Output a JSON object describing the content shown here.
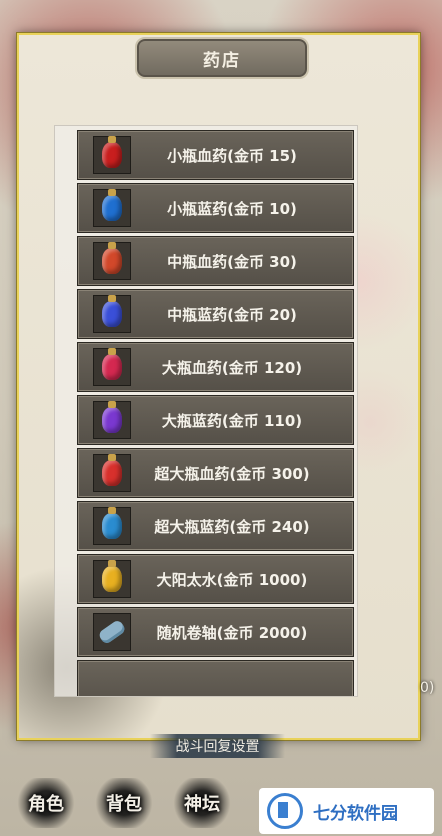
{
  "shop": {
    "title": "药店",
    "items": [
      {
        "label": "小瓶血药(金币 15)",
        "color": "#c81e1e",
        "icon": "small-red-potion-icon"
      },
      {
        "label": "小瓶蓝药(金币 10)",
        "color": "#1f6fd0",
        "icon": "small-blue-potion-icon"
      },
      {
        "label": "中瓶血药(金币 30)",
        "color": "#d2482a",
        "icon": "medium-red-potion-icon"
      },
      {
        "label": "中瓶蓝药(金币 20)",
        "color": "#3a4fd8",
        "icon": "medium-blue-potion-icon"
      },
      {
        "label": "大瓶血药(金币 120)",
        "color": "#d42850",
        "icon": "large-red-potion-icon"
      },
      {
        "label": "大瓶蓝药(金币 110)",
        "color": "#7a38d0",
        "icon": "large-blue-potion-icon"
      },
      {
        "label": "超大瓶血药(金币 300)",
        "color": "#d8302c",
        "icon": "xl-red-potion-icon"
      },
      {
        "label": "超大瓶蓝药(金币 240)",
        "color": "#2a8cd0",
        "icon": "xl-blue-potion-icon"
      },
      {
        "label": "大阳太水(金币 1000)",
        "color": "#e8b020",
        "icon": "sun-water-icon"
      },
      {
        "label": "随机卷轴(金币 2000)",
        "color": "#8fb3c9",
        "icon": "scroll-icon"
      }
    ]
  },
  "settings_button": "战斗回复设置",
  "nav": [
    {
      "label": "角色"
    },
    {
      "label": "背包"
    },
    {
      "label": "神坛"
    }
  ],
  "side_number": "0)",
  "watermark": "七分软件园"
}
